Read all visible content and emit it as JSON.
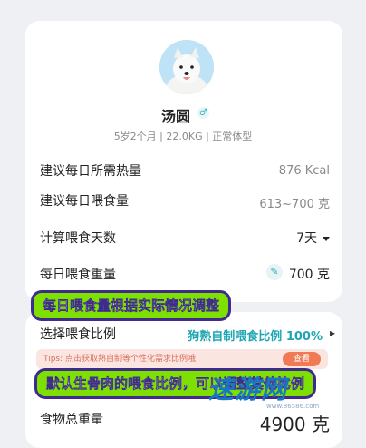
{
  "pet": {
    "name": "汤圆",
    "gender_icon": "♂",
    "meta": "5岁2个月 | 22.0KG | 正常体型"
  },
  "rows": {
    "calories_label": "建议每日所需热量",
    "calories_value": "876 Kcal",
    "feeding_label": "建议每日喂食量",
    "feeding_value": "613~700 克",
    "days_label": "计算喂食天数",
    "days_value": "7天",
    "daily_weight_label": "每日喂食重量",
    "daily_weight_value": "700 克",
    "ratio_label": "选择喂食比例",
    "ratio_value": "狗熟自制喂食比例 100%",
    "total_label": "食物总重量",
    "total_value": "4900 克"
  },
  "tips": {
    "text": "Tips: 点击获取熟自制等个性化需求比例哦",
    "button": "查看"
  },
  "banners": {
    "top": "每日喂食量根据实际情况调整",
    "bottom": "默认生骨肉的喂食比例，可以调整其他比例"
  },
  "watermark": {
    "text": "速游网",
    "sub": "www.86586.com"
  },
  "icons": {
    "edit": "edit-icon",
    "gender": "male-icon",
    "dropdown": "caret-down-icon",
    "chevron": "chevron-right-icon"
  }
}
